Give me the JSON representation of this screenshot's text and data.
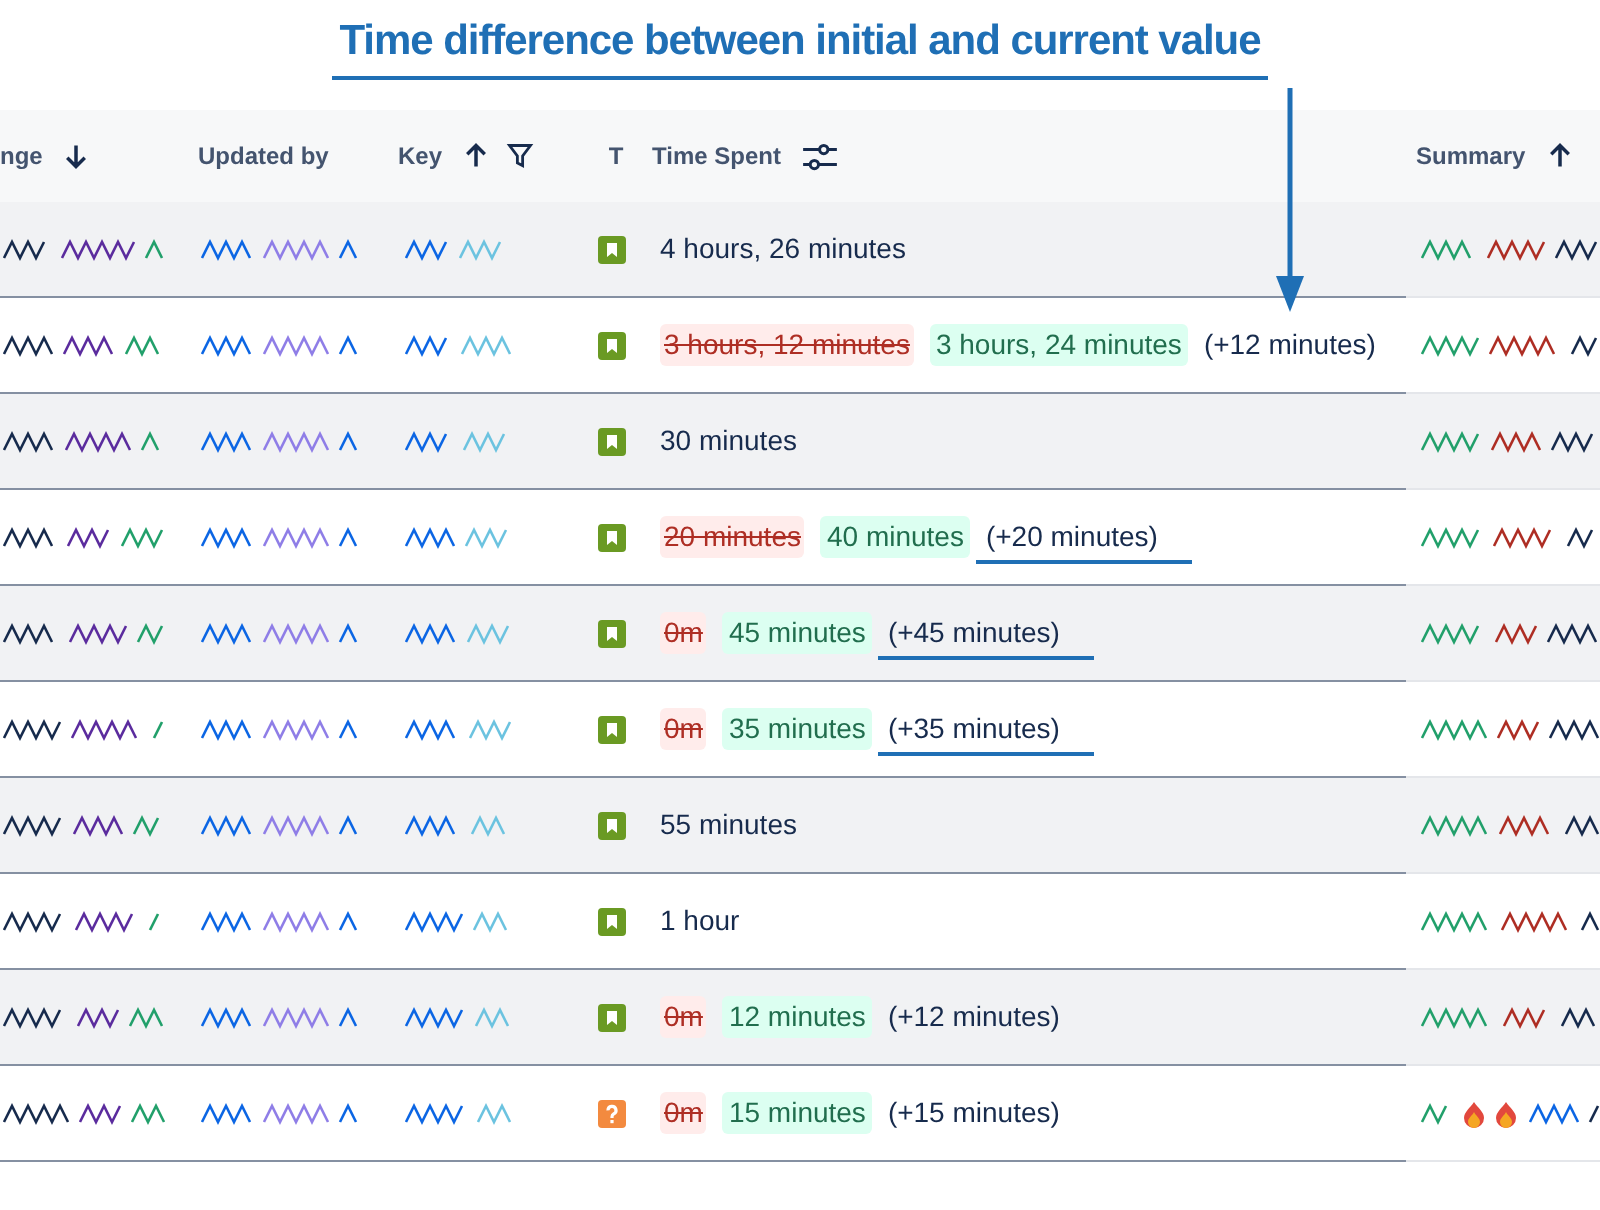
{
  "annotation": {
    "title": "Time difference between initial and current value"
  },
  "table": {
    "columns": [
      {
        "label": "nge",
        "sort_ascending": false,
        "sort_descending": true,
        "filter": false,
        "settings": false
      },
      {
        "label": "Updated by",
        "sort_ascending": false,
        "sort_descending": false,
        "filter": false,
        "settings": false
      },
      {
        "label": "Key",
        "sort_ascending": true,
        "sort_descending": false,
        "filter": true,
        "settings": false
      },
      {
        "label": "T",
        "sort_ascending": false,
        "sort_descending": false,
        "filter": false,
        "settings": false
      },
      {
        "label": "Time Spent",
        "sort_ascending": false,
        "sort_descending": false,
        "filter": false,
        "settings": true
      },
      {
        "label": "Summary",
        "sort_ascending": true,
        "sort_descending": false,
        "filter": false,
        "settings": false
      }
    ],
    "rows": [
      {
        "kind": "story",
        "summary_flames": false,
        "time_spent": {
          "kind": "plain",
          "text": "4 hours, 26 minutes"
        }
      },
      {
        "kind": "story",
        "summary_flames": false,
        "time_spent": {
          "kind": "change",
          "old": "3 hours, 12 minutes",
          "new": "3 hours, 24 minutes",
          "diff": "(+12 minutes)",
          "underlined": false,
          "arrow": true
        }
      },
      {
        "kind": "story",
        "summary_flames": false,
        "time_spent": {
          "kind": "plain",
          "text": "30 minutes"
        }
      },
      {
        "kind": "story",
        "summary_flames": false,
        "time_spent": {
          "kind": "change",
          "old": "20 minutes",
          "new": "40 minutes",
          "diff": "(+20 minutes)",
          "underlined": true,
          "arrow": false
        }
      },
      {
        "kind": "story",
        "summary_flames": false,
        "time_spent": {
          "kind": "change",
          "old": "0m",
          "new": "45 minutes",
          "diff": "(+45 minutes)",
          "underlined": true,
          "arrow": false
        }
      },
      {
        "kind": "story",
        "summary_flames": false,
        "time_spent": {
          "kind": "change",
          "old": "0m",
          "new": "35 minutes",
          "diff": "(+35 minutes)",
          "underlined": true,
          "arrow": false
        }
      },
      {
        "kind": "story",
        "summary_flames": false,
        "time_spent": {
          "kind": "plain",
          "text": "55 minutes"
        }
      },
      {
        "kind": "story",
        "summary_flames": false,
        "time_spent": {
          "kind": "plain",
          "text": "1 hour"
        }
      },
      {
        "kind": "story",
        "summary_flames": false,
        "time_spent": {
          "kind": "change",
          "old": "0m",
          "new": "12 minutes",
          "diff": "(+12 minutes)",
          "underlined": false,
          "arrow": false
        }
      },
      {
        "kind": "question",
        "summary_flames": true,
        "time_spent": {
          "kind": "change",
          "old": "0m",
          "new": "15 minutes",
          "diff": "(+15 minutes)",
          "underlined": false,
          "arrow": false
        }
      }
    ]
  }
}
